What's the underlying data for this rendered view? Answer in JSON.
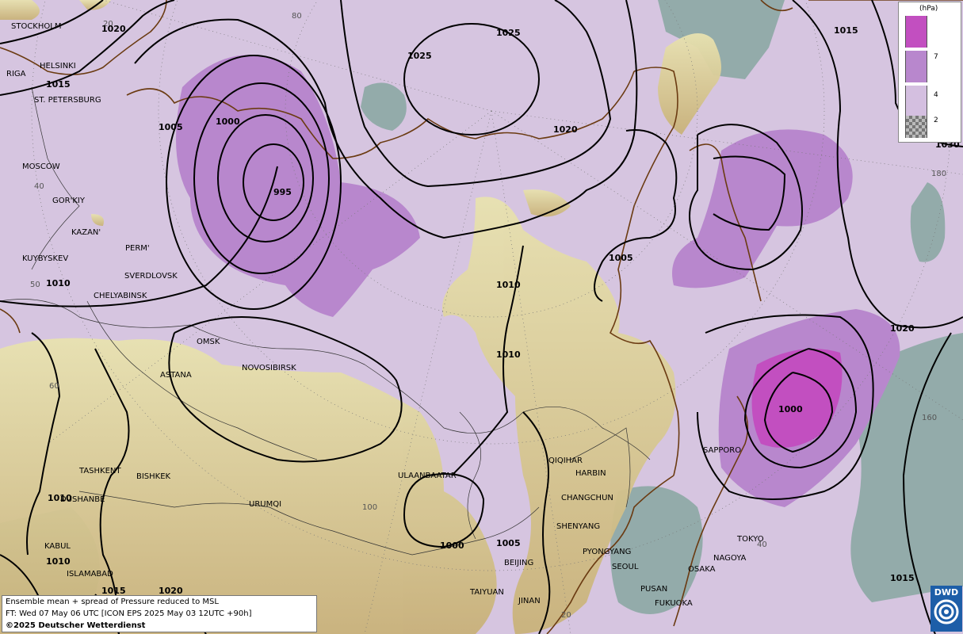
{
  "legend": {
    "unit": "(hPa)",
    "ticks": [
      "7",
      "4",
      "2"
    ],
    "colors": [
      "#c24fc0",
      "#b887cd",
      "#d4bfe0",
      "#9aa"
    ]
  },
  "info": {
    "line1": "Ensemble mean + spread of Pressure reduced to MSL",
    "line2": "FT: Wed 07 May 06 UTC [ICON EPS 2025 May 03 12UTC +90h]",
    "line3": "©2025 Deutscher Wetterdienst"
  },
  "logo": {
    "text": "DWD"
  },
  "cities": {
    "stockholm": "STOCKHOLM",
    "helsinki": "HELSINKI",
    "riga": "RIGA",
    "st_petersburg": "ST. PETERSBURG",
    "moscow": "MOSCOW",
    "gorkiy": "GOR'KIY",
    "kazan": "KAZAN'",
    "perm": "PERM'",
    "kuybyskev": "KUYBYSKEV",
    "sverdlovsk": "SVERDLOVSK",
    "chelyabinsk": "CHELYABINSK",
    "omsk": "OMSK",
    "astana": "ASTANA",
    "novosibirsk": "NOVOSIBIRSK",
    "tashkent": "TASHKENT",
    "bishkek": "BISHKEK",
    "dushanbe": "DUSHANBE",
    "urumqi": "URUMQI",
    "kabul": "KABUL",
    "islamabad": "ISLAMABAD",
    "ulaanbaatar": "ULAANBAATAR",
    "qiqihar": "QIQIHAR",
    "harbin": "HARBIN",
    "changchun": "CHANGCHUN",
    "shenyang": "SHENYANG",
    "pyongyang": "PYONGYANG",
    "seoul": "SEOUL",
    "pusan": "PUSAN",
    "fukuoka": "FUKUOKA",
    "osaka": "OSAKA",
    "nagoya": "NAGOYA",
    "tokyo": "TOKYO",
    "sapporo": "SAPPORO",
    "beijing": "BEIJING",
    "taiyuan": "TAIYUAN",
    "jinan": "JINAN"
  },
  "isobars": {
    "l1020_nw": "1020",
    "l1015_nw": "1015",
    "l1005_w": "1005",
    "l1000_w": "1000",
    "l995": "995",
    "l1025_a": "1025",
    "l1025_b": "1025",
    "l1020_n": "1020",
    "l1015_ne": "1015",
    "l1030": "1030",
    "l1010_w": "1010",
    "l1005_c": "1005",
    "l1010_c1": "1010",
    "l1010_c2": "1010",
    "l1020_e": "1020",
    "l1000_e": "1000",
    "l1015_se": "1015",
    "l1000_s": "1000",
    "l1005_s": "1005",
    "l1010_sw": "1010",
    "l1015_sw": "1015",
    "l1020_sw": "1020",
    "l1010_sw2": "1010"
  },
  "grid": {
    "g20": "20",
    "g80": "80",
    "g40": "40",
    "g50": "50",
    "g60": "60",
    "g100": "100",
    "g180": "180",
    "g160": "160",
    "g20s": "20",
    "g40e": "40"
  }
}
